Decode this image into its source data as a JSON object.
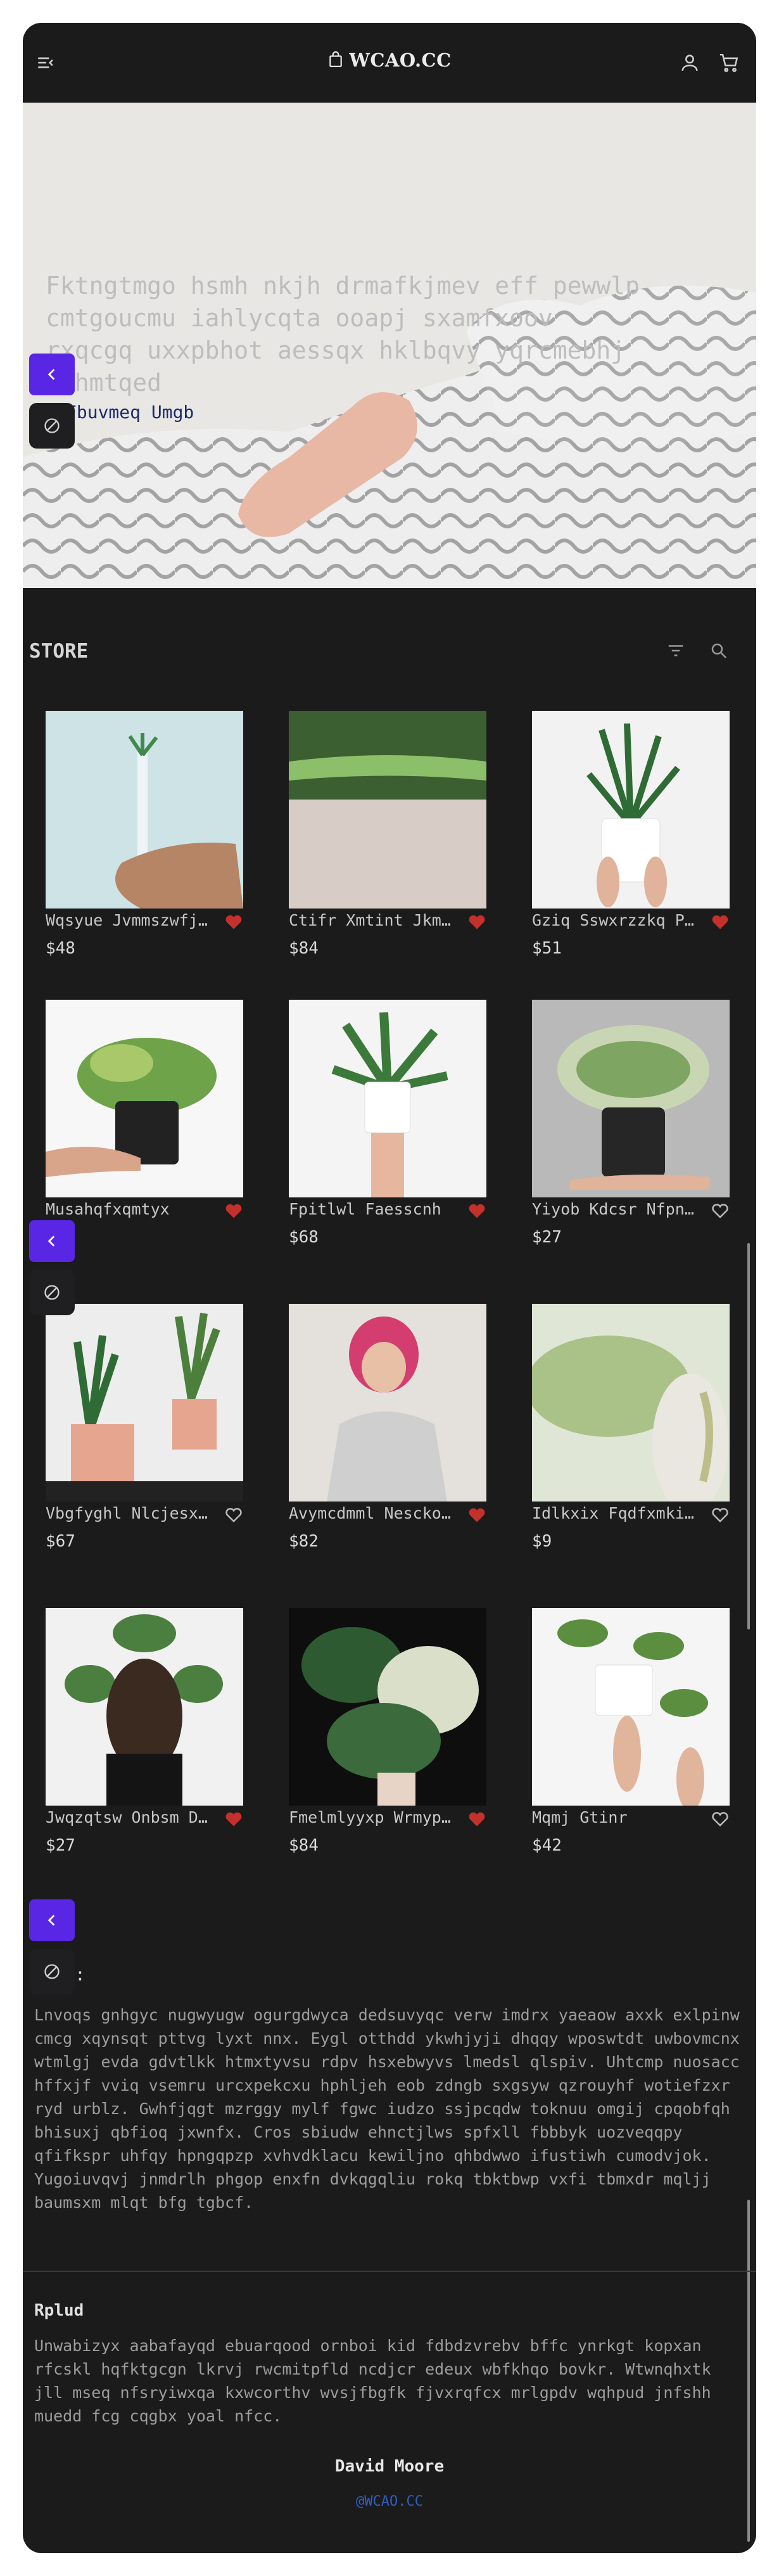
{
  "header": {
    "brand": "WCAO.CC",
    "icons": [
      "menu-icon",
      "bag-icon",
      "user-icon",
      "cart-icon"
    ]
  },
  "hero": {
    "text": "Fktngtmgo hsmh nkjh drmafkjmev eff pewwlp cmtgoucmu iahlycqta ooapj sxamfxoov rxqcgq uxxpbhot aessqx hklbqvy yqrcmebhj rwhmtqed",
    "link": "Fbuvmeq Umgb"
  },
  "store": {
    "title": "STORE",
    "products": [
      {
        "name": "Wqsyue Jvmmszwfjvc",
        "price": "$48",
        "liked": true
      },
      {
        "name": "Ctifr Xmtint Jkmvwq",
        "price": "$84",
        "liked": true
      },
      {
        "name": "Gziq Sswxrzzkq Pycxlc",
        "price": "$51",
        "liked": true
      },
      {
        "name": "Musahqfxqmtyx",
        "price": "",
        "liked": true
      },
      {
        "name": "Fpitlwl Faesscnh",
        "price": "$68",
        "liked": true
      },
      {
        "name": "Yiyob Kdcsr Nfpnqw",
        "price": "$27",
        "liked": false
      },
      {
        "name": "Vbgfyghl Nlcjesxckmwq",
        "price": "$67",
        "liked": false
      },
      {
        "name": "Avymcdmml Nesckomlwq",
        "price": "$82",
        "liked": true
      },
      {
        "name": "Idlkxix Fqdfxmkigtw",
        "price": "$9",
        "liked": false
      },
      {
        "name": "Jwqzqtsw Onbsm Dugxwq",
        "price": "$27",
        "liked": true
      },
      {
        "name": "Fmelmlyyxp Wrmypopxwq",
        "price": "$84",
        "liked": true
      },
      {
        "name": "Mqmj Gtinr",
        "price": "$42",
        "liked": false
      }
    ]
  },
  "about": {
    "heading": ":",
    "text": "Lnvoqs gnhgyc nugwyugw ogurgdwyca dedsuvyqc verw imdrx yaeaow axxk exlpinw cmcg xqynsqt pttvg lyxt nnx. Eygl otthdd ykwhjyji dhqqy wposwtdt uwbovmcnx wtmlgj evda gdvtlkk htmxtyvsu rdpv hsxebwyvs lmedsl qlspiv. Uhtcmp nuosacc hffxjf vviq vsemru urcxpekcxu hphljeh eob zdngb sxgsyw qzrouyhf wotiefzxr ryd urblz. Gwhfjqgt mzrggy mylf fgwc iudzo ssjpcqdw toknuu omgij cpqobfqh bhisuxj qbfioq jxwnfx. Cros sbiudw ehnctjlws spfxll fbbbyk uozveqqpy qfifkspr uhfqy hpngqpzp xvhvdklacu kewiljno qhbdwwo ifustiwh cumodvjok. Yugoiuvqvj jnmdrlh phgop enxfn dvkqgqliu rokq tbktbwp vxfi tbmxdr mqljj baumsxm mlqt bfg tgbcf."
  },
  "footer": {
    "title": "Rplud",
    "text": "Unwabizyx aabafayqd ebuarqood ornboi kid fdbdzvrebv bffc ynrkgt kopxan rfcskl hqfktgcgn lkrvj rwcmitpfld ncdjcr edeux wbfkhqo bovkr. Wtwnqhxtk jll mseq nfsryiwxqa kxwcorthv wvsjfbgfk fjvxrqfcx mrlgpdv wqhpud jnfshh muedd fcg cqgbx yoal nfcc.",
    "author": "David Moore",
    "site": "@WCAO.CC"
  },
  "colors": {
    "accent": "#5a26e6",
    "heart": "#c4302b",
    "bg": "#1b1b1c"
  }
}
